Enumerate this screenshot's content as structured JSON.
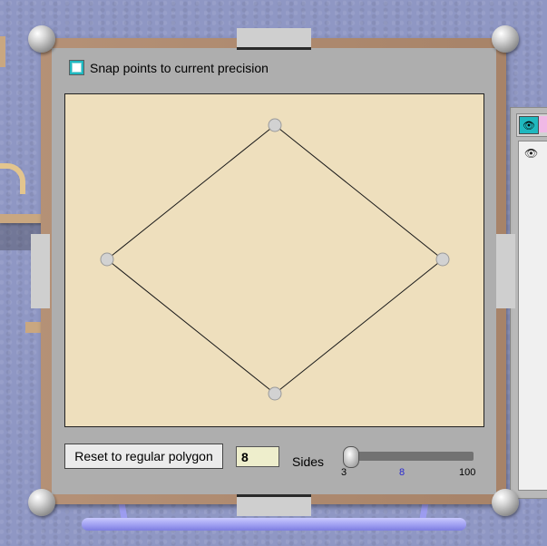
{
  "snap": {
    "label": "Snap points to current precision",
    "checked": false
  },
  "polygon": {
    "sides": 4,
    "stroke_color": "#1a1a1a",
    "point_color": "#d2d2d2",
    "canvas_color": "#eedfbd"
  },
  "controls": {
    "reset_label": "Reset to regular polygon",
    "sides_value": "8",
    "sides_label": "Sides",
    "slider_min": "3",
    "slider_current": "8",
    "slider_max": "100",
    "slider_current_color": "#2a2ad0"
  },
  "side_panel": {
    "top_icon": "eye-icon",
    "list_icon": "eye-icon"
  }
}
